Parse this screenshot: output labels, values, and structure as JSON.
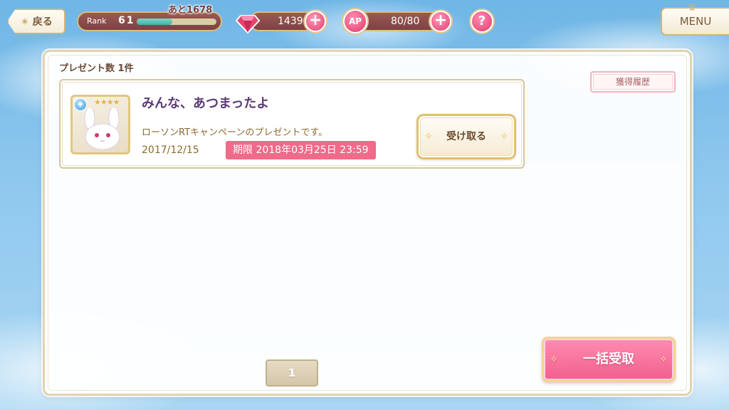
{
  "header": {
    "back_label": "戻る",
    "rank_label": "Rank",
    "rank_value": "61",
    "rank_next": "あと1678",
    "rank_progress": 0.45,
    "gems": "1439",
    "ap_label": "AP",
    "ap_value": "80/80",
    "help_label": "?",
    "menu_label": "MENU",
    "plus_label": "+"
  },
  "main": {
    "present_count": "プレゼント数  1件",
    "history_label": "獲得履歴",
    "items": [
      {
        "title": "みんな、あつまったよ",
        "description": "ローソンRTキャンペーンのプレゼントです。",
        "date": "2017/12/15",
        "deadline": "期限 2018年03月25日 23:59",
        "receive_label": "受け取る",
        "stars": "★★★★",
        "icon": "white-creature-card-icon"
      }
    ],
    "page": "1",
    "bulk_label": "一括受取"
  },
  "colors": {
    "accent_pink": "#f15f8d",
    "deadline_pink": "#f06a8a",
    "gold_border": "#e2c06e",
    "title_purple": "#5b3a76"
  }
}
